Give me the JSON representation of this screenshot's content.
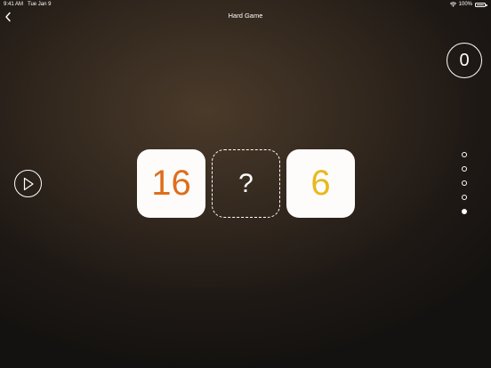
{
  "status_bar": {
    "time": "9:41 AM",
    "date": "Tue Jan 9",
    "battery": "100%"
  },
  "nav": {
    "title": "Hard Game",
    "back_icon": "chevron-left-icon"
  },
  "score": {
    "value": "0"
  },
  "play": {
    "icon": "play-icon"
  },
  "puzzle": {
    "left_number": "16",
    "middle_symbol": "?",
    "right_number": "6",
    "colors": {
      "left_number": "#dd6e1c",
      "right_number": "#e8b81d",
      "tile_bg": "#fdfcfa"
    }
  },
  "progress": {
    "total": 5,
    "current_index": 4
  }
}
